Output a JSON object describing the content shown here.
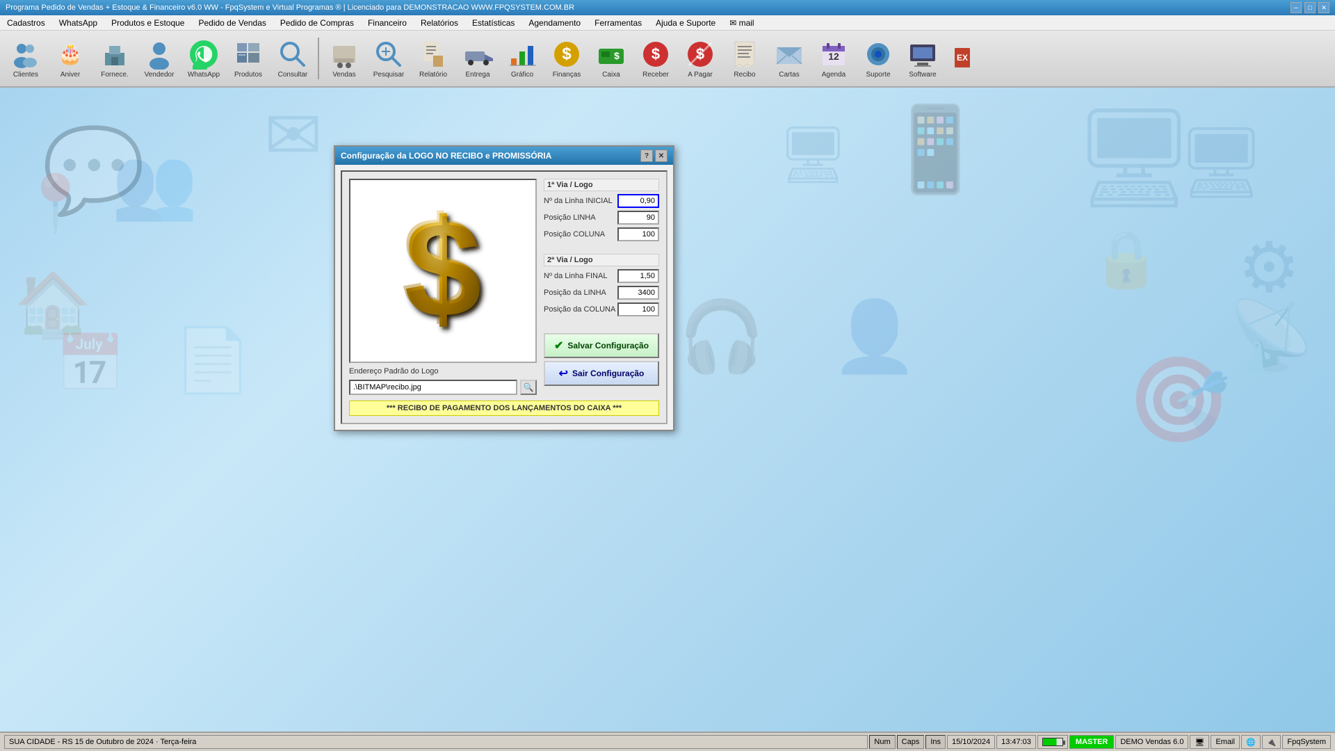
{
  "titlebar": {
    "title": "Programa Pedido de Vendas + Estoque & Financeiro v6.0 WW - FpqSystem e Virtual Programas ® | Licenciado para  DEMONSTRACAO WWW.FPQSYSTEM.COM.BR"
  },
  "menubar": {
    "items": [
      {
        "label": "Cadastros"
      },
      {
        "label": "WhatsApp"
      },
      {
        "label": "Produtos e Estoque"
      },
      {
        "label": "Pedido de Vendas"
      },
      {
        "label": "Pedido de Compras"
      },
      {
        "label": "Financeiro"
      },
      {
        "label": "Relatórios"
      },
      {
        "label": "Estatísticas"
      },
      {
        "label": "Agendamento"
      },
      {
        "label": "Ferramentas"
      },
      {
        "label": "Ajuda e Suporte"
      },
      {
        "label": "✉ mail"
      }
    ]
  },
  "toolbar": {
    "buttons": [
      {
        "label": "Clientes",
        "icon": "👥"
      },
      {
        "label": "Aniver",
        "icon": "🎂"
      },
      {
        "label": "Fornece.",
        "icon": "🏭"
      },
      {
        "label": "Vendedor",
        "icon": "👤"
      },
      {
        "label": "WhatsApp",
        "icon": "📱"
      },
      {
        "label": "Produtos",
        "icon": "📦"
      },
      {
        "label": "Consultar",
        "icon": "🔍"
      },
      {
        "label": "Vendas",
        "icon": "🛒"
      },
      {
        "label": "Pesquisar",
        "icon": "🔎"
      },
      {
        "label": "Relatório",
        "icon": "📊"
      },
      {
        "label": "Entrega",
        "icon": "🚚"
      },
      {
        "label": "Gráfico",
        "icon": "📈"
      },
      {
        "label": "Finanças",
        "icon": "💰"
      },
      {
        "label": "Caixa",
        "icon": "💵"
      },
      {
        "label": "Receber",
        "icon": "💳"
      },
      {
        "label": "A Pagar",
        "icon": "💸"
      },
      {
        "label": "Recibo",
        "icon": "🧾"
      },
      {
        "label": "Cartas",
        "icon": "✉"
      },
      {
        "label": "Agenda",
        "icon": "📅"
      },
      {
        "label": "Suporte",
        "icon": "🛠"
      },
      {
        "label": "Software",
        "icon": "💻"
      },
      {
        "label": "",
        "icon": "⬛"
      }
    ]
  },
  "dialog": {
    "title": "Configuração da LOGO NO RECIBO e PROMISSÓRIA",
    "section1": {
      "header": "1ª Via / Logo",
      "fields": [
        {
          "label": "Nº da Linha INICIAL",
          "value": "0,90",
          "active": true
        },
        {
          "label": "Posição LINHA",
          "value": "90"
        },
        {
          "label": "Posição COLUNA",
          "value": "100"
        }
      ]
    },
    "section2": {
      "header": "2ª Via / Logo",
      "fields": [
        {
          "label": "Nº da Linha FINAL",
          "value": "1,50"
        },
        {
          "label": "Posição da LINHA",
          "value": "3400"
        },
        {
          "label": "Posição da COLUNA",
          "value": "100"
        }
      ]
    },
    "address": {
      "label": "Endereço Padrão do Logo",
      "value": ".\\BITMAP\\recibo.jpg"
    },
    "buttons": {
      "save": "Salvar Configuração",
      "exit": "Sair Configuração"
    },
    "notice": "*** RECIBO DE PAGAMENTO DOS LANÇAMENTOS DO CAIXA ***"
  },
  "statusbar": {
    "city": "SUA CIDADE - RS 15 de Outubro de 2024 · Terça-feira",
    "num": "Num",
    "caps": "Caps",
    "ins": "Ins",
    "date": "15/10/2024",
    "time": "13:47:03",
    "battery": "🔋",
    "master": "MASTER",
    "demo": "DEMO Vendas 6.0",
    "email": "Email",
    "fpqsystem": "FpqSystem"
  }
}
